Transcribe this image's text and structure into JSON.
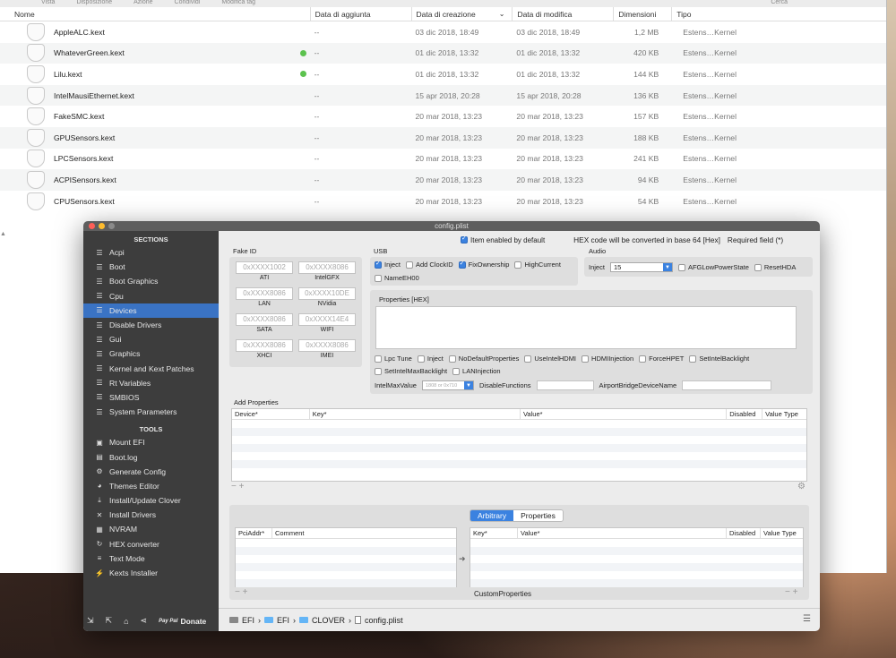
{
  "finder": {
    "toolbar": [
      "Vista",
      "Disposizione",
      "Azione",
      "Condividi",
      "Modifica tag"
    ],
    "toolbar_right": "Cerca",
    "columns": {
      "name": "Nome",
      "added": "Data di aggiunta",
      "created": "Data di creazione",
      "modified": "Data di modifica",
      "size": "Dimensioni",
      "type": "Tipo"
    },
    "files": [
      {
        "name": "AppleALC.kext",
        "added": "--",
        "created": "03 dic 2018, 18:49",
        "modified": "03 dic 2018, 18:49",
        "size": "1,2 MB",
        "type": "Estens…Kernel",
        "tag": false
      },
      {
        "name": "WhateverGreen.kext",
        "added": "--",
        "created": "01 dic 2018, 13:32",
        "modified": "01 dic 2018, 13:32",
        "size": "420 KB",
        "type": "Estens…Kernel",
        "tag": true
      },
      {
        "name": "Lilu.kext",
        "added": "--",
        "created": "01 dic 2018, 13:32",
        "modified": "01 dic 2018, 13:32",
        "size": "144 KB",
        "type": "Estens…Kernel",
        "tag": true
      },
      {
        "name": "IntelMausiEthernet.kext",
        "added": "--",
        "created": "15 apr 2018, 20:28",
        "modified": "15 apr 2018, 20:28",
        "size": "136 KB",
        "type": "Estens…Kernel",
        "tag": false
      },
      {
        "name": "FakeSMC.kext",
        "added": "--",
        "created": "20 mar 2018, 13:23",
        "modified": "20 mar 2018, 13:23",
        "size": "157 KB",
        "type": "Estens…Kernel",
        "tag": false
      },
      {
        "name": "GPUSensors.kext",
        "added": "--",
        "created": "20 mar 2018, 13:23",
        "modified": "20 mar 2018, 13:23",
        "size": "188 KB",
        "type": "Estens…Kernel",
        "tag": false
      },
      {
        "name": "LPCSensors.kext",
        "added": "--",
        "created": "20 mar 2018, 13:23",
        "modified": "20 mar 2018, 13:23",
        "size": "241 KB",
        "type": "Estens…Kernel",
        "tag": false
      },
      {
        "name": "ACPISensors.kext",
        "added": "--",
        "created": "20 mar 2018, 13:23",
        "modified": "20 mar 2018, 13:23",
        "size": "94 KB",
        "type": "Estens…Kernel",
        "tag": false
      },
      {
        "name": "CPUSensors.kext",
        "added": "--",
        "created": "20 mar 2018, 13:23",
        "modified": "20 mar 2018, 13:23",
        "size": "54 KB",
        "type": "Estens…Kernel",
        "tag": false
      }
    ]
  },
  "clover": {
    "title": "config.plist",
    "sections_title": "SECTIONS",
    "sections": [
      "Acpi",
      "Boot",
      "Boot Graphics",
      "Cpu",
      "Devices",
      "Disable Drivers",
      "Gui",
      "Graphics",
      "Kernel and Kext Patches",
      "Rt Variables",
      "SMBIOS",
      "System Parameters"
    ],
    "active_section": "Devices",
    "tools_title": "TOOLS",
    "tools": [
      {
        "label": "Mount EFI",
        "icon": "disk-icon",
        "glyph": "▣"
      },
      {
        "label": "Boot.log",
        "icon": "log-icon",
        "glyph": "▤"
      },
      {
        "label": "Generate Config",
        "icon": "gear-icon",
        "glyph": "⚙"
      },
      {
        "label": "Themes Editor",
        "icon": "palette-icon",
        "glyph": "◕"
      },
      {
        "label": "Install/Update Clover",
        "icon": "download-icon",
        "glyph": "⤓"
      },
      {
        "label": "Install Drivers",
        "icon": "tools-icon",
        "glyph": "✕"
      },
      {
        "label": "NVRAM",
        "icon": "chip-icon",
        "glyph": "▦"
      },
      {
        "label": "HEX converter",
        "icon": "refresh-icon",
        "glyph": "↻"
      },
      {
        "label": "Text Mode",
        "icon": "text-icon",
        "glyph": "≡"
      },
      {
        "label": "Kexts Installer",
        "icon": "plug-icon",
        "glyph": "⚡"
      }
    ],
    "donate": "Donate",
    "donate_logo": "Pay Pal",
    "topline": {
      "enabled_label": "Item enabled by default",
      "hex_note": "HEX code will be converted in base 64 [Hex]",
      "required": "Required field (*)"
    },
    "fake_id": {
      "title": "Fake ID",
      "fields": [
        {
          "placeholder": "0xXXXX1002",
          "label": "ATI"
        },
        {
          "placeholder": "0xXXXX8086",
          "label": "IntelGFX"
        },
        {
          "placeholder": "0xXXXX8086",
          "label": "LAN"
        },
        {
          "placeholder": "0xXXXX10DE",
          "label": "NVidia"
        },
        {
          "placeholder": "0xXXXX8086",
          "label": "SATA"
        },
        {
          "placeholder": "0xXXXX14E4",
          "label": "WIFI"
        },
        {
          "placeholder": "0xXXXX8086",
          "label": "XHCI"
        },
        {
          "placeholder": "0xXXXX8086",
          "label": "IMEI"
        }
      ]
    },
    "usb": {
      "title": "USB",
      "inject": "Inject",
      "add_clock": "Add ClockID",
      "fix_ownership": "FixOwnership",
      "high_current": "HighCurrent",
      "name_eh00": "NameEH00"
    },
    "audio": {
      "title": "Audio",
      "inject_label": "Inject",
      "inject_value": "15",
      "afg": "AFGLowPowerState",
      "reset_hda": "ResetHDA"
    },
    "properties": {
      "title": "Properties [HEX]",
      "checks": [
        "Lpc Tune",
        "Inject",
        "NoDefaultProperties",
        "UseIntelHDMI",
        "HDMIInjection",
        "ForceHPET",
        "SetIntelBacklight",
        "SetIntelMaxBacklight",
        "LANInjection"
      ],
      "intel_max_label": "IntelMaxValue",
      "intel_max_placeholder": "1808 or 0x710",
      "disable_functions": "DisableFunctions",
      "airport": "AirportBridgeDeviceName"
    },
    "add_properties": {
      "title": "Add Properties",
      "cols": [
        "Device*",
        "Key*",
        "Value*",
        "Disabled",
        "Value Type"
      ]
    },
    "segment": {
      "arbitrary": "Arbitrary",
      "properties": "Properties"
    },
    "arbitrary": {
      "left_cols": [
        "PciAddr*",
        "Comment"
      ],
      "right_cols": [
        "Key*",
        "Value*",
        "Disabled",
        "Value Type"
      ],
      "custom_label": "CustomProperties"
    },
    "path": [
      "EFI",
      "EFI",
      "CLOVER",
      "config.plist"
    ]
  }
}
